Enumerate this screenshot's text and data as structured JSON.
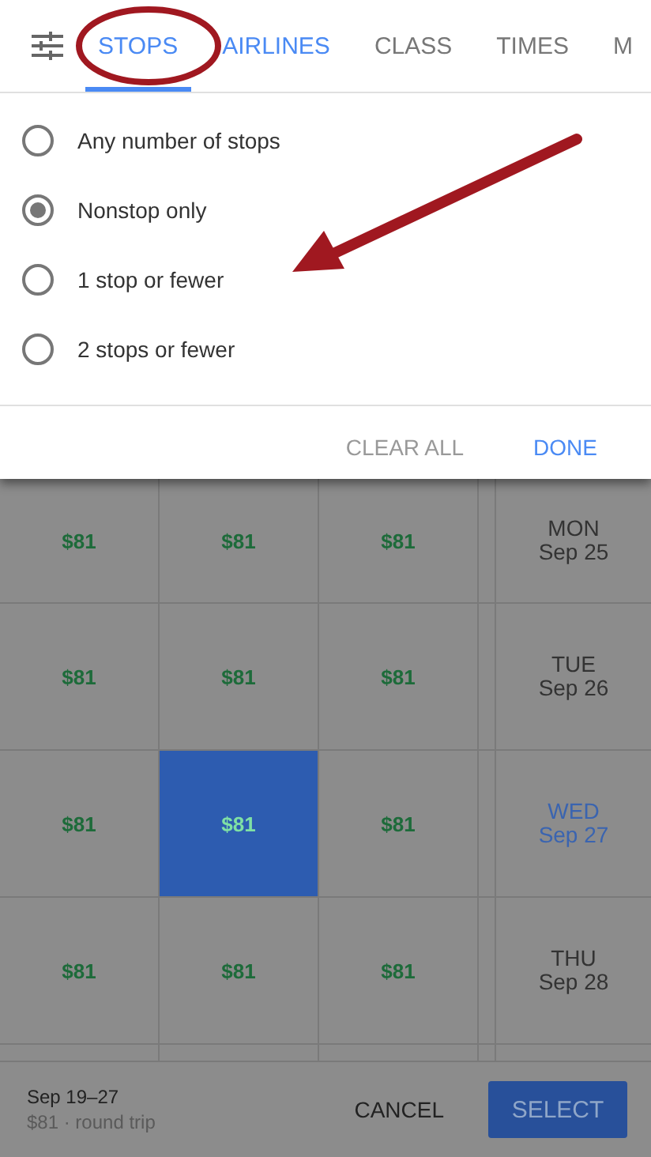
{
  "filter_panel": {
    "tabs": [
      {
        "label": "STOPS",
        "selected": true,
        "applied": true
      },
      {
        "label": "AIRLINES",
        "selected": false,
        "applied": true
      },
      {
        "label": "CLASS",
        "selected": false,
        "applied": false
      },
      {
        "label": "TIMES",
        "selected": false,
        "applied": false
      },
      {
        "label": "M",
        "selected": false,
        "applied": false
      }
    ],
    "options": [
      {
        "label": "Any number of stops",
        "selected": false
      },
      {
        "label": "Nonstop only",
        "selected": true
      },
      {
        "label": "1 stop or fewer",
        "selected": false
      },
      {
        "label": "2 stops or fewer",
        "selected": false
      }
    ],
    "buttons": {
      "clear": "CLEAR ALL",
      "done": "DONE"
    }
  },
  "price_grid": {
    "rows": [
      {
        "cells": [
          {
            "price": "$81",
            "selected": false
          },
          {
            "price": "$81",
            "selected": false
          },
          {
            "price": "$81",
            "selected": false
          }
        ],
        "day": "MON",
        "date": "Sep 25",
        "selected": false
      },
      {
        "cells": [
          {
            "price": "$81",
            "selected": false
          },
          {
            "price": "$81",
            "selected": false
          },
          {
            "price": "$81",
            "selected": false
          }
        ],
        "day": "TUE",
        "date": "Sep 26",
        "selected": false
      },
      {
        "cells": [
          {
            "price": "$81",
            "selected": false
          },
          {
            "price": "$81",
            "selected": true
          },
          {
            "price": "$81",
            "selected": false
          }
        ],
        "day": "WED",
        "date": "Sep 27",
        "selected": true
      },
      {
        "cells": [
          {
            "price": "$81",
            "selected": false
          },
          {
            "price": "$81",
            "selected": false
          },
          {
            "price": "$81",
            "selected": false
          }
        ],
        "day": "THU",
        "date": "Sep 28",
        "selected": false
      }
    ]
  },
  "bottom_bar": {
    "dates": "Sep 19–27",
    "summary": "$81 · round trip",
    "cancel": "CANCEL",
    "select": "SELECT"
  }
}
